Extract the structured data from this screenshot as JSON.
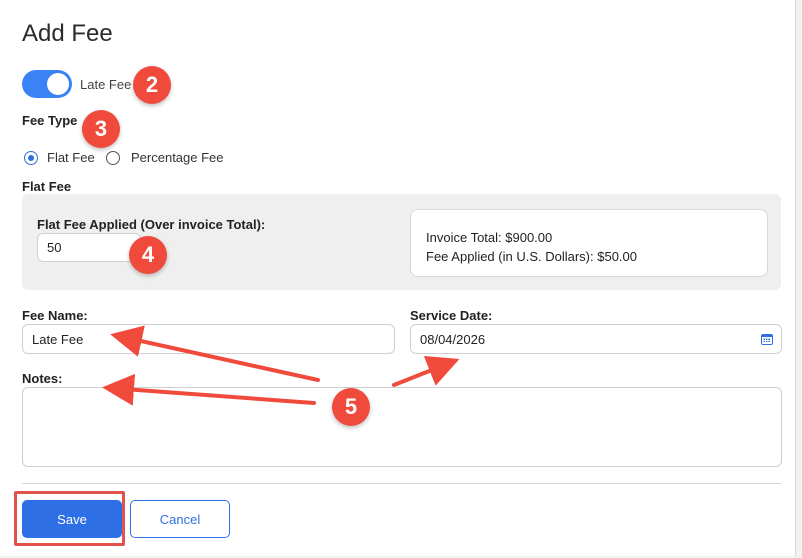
{
  "dialog": {
    "title": "Add Fee"
  },
  "late_fee_toggle": {
    "label": "Late Fee",
    "on": true
  },
  "fee_type": {
    "label": "Fee Type",
    "options": [
      {
        "label": "Flat Fee",
        "selected": true
      },
      {
        "label": "Percentage Fee",
        "selected": false
      }
    ]
  },
  "flat_fee": {
    "section_label": "Flat Fee",
    "applied_label": "Flat Fee Applied (Over invoice Total):",
    "applied_value": "50",
    "summary": {
      "invoice_total": "Invoice Total: $900.00",
      "fee_applied": "Fee Applied (in U.S. Dollars): $50.00"
    }
  },
  "fee_name": {
    "label": "Fee Name:",
    "value": "Late Fee"
  },
  "service_date": {
    "label": "Service Date:",
    "value": "08/04/2026"
  },
  "notes": {
    "label": "Notes:",
    "value": ""
  },
  "actions": {
    "save_label": "Save",
    "cancel_label": "Cancel"
  },
  "annotations": {
    "badge_toggle": "2",
    "badge_fee_type": "3",
    "badge_flat_fee": "4",
    "badge_fields": "5"
  },
  "colors": {
    "primary": "#2f6fe6",
    "toggle_on": "#3b82f6",
    "annotation": "#f04a3c"
  }
}
